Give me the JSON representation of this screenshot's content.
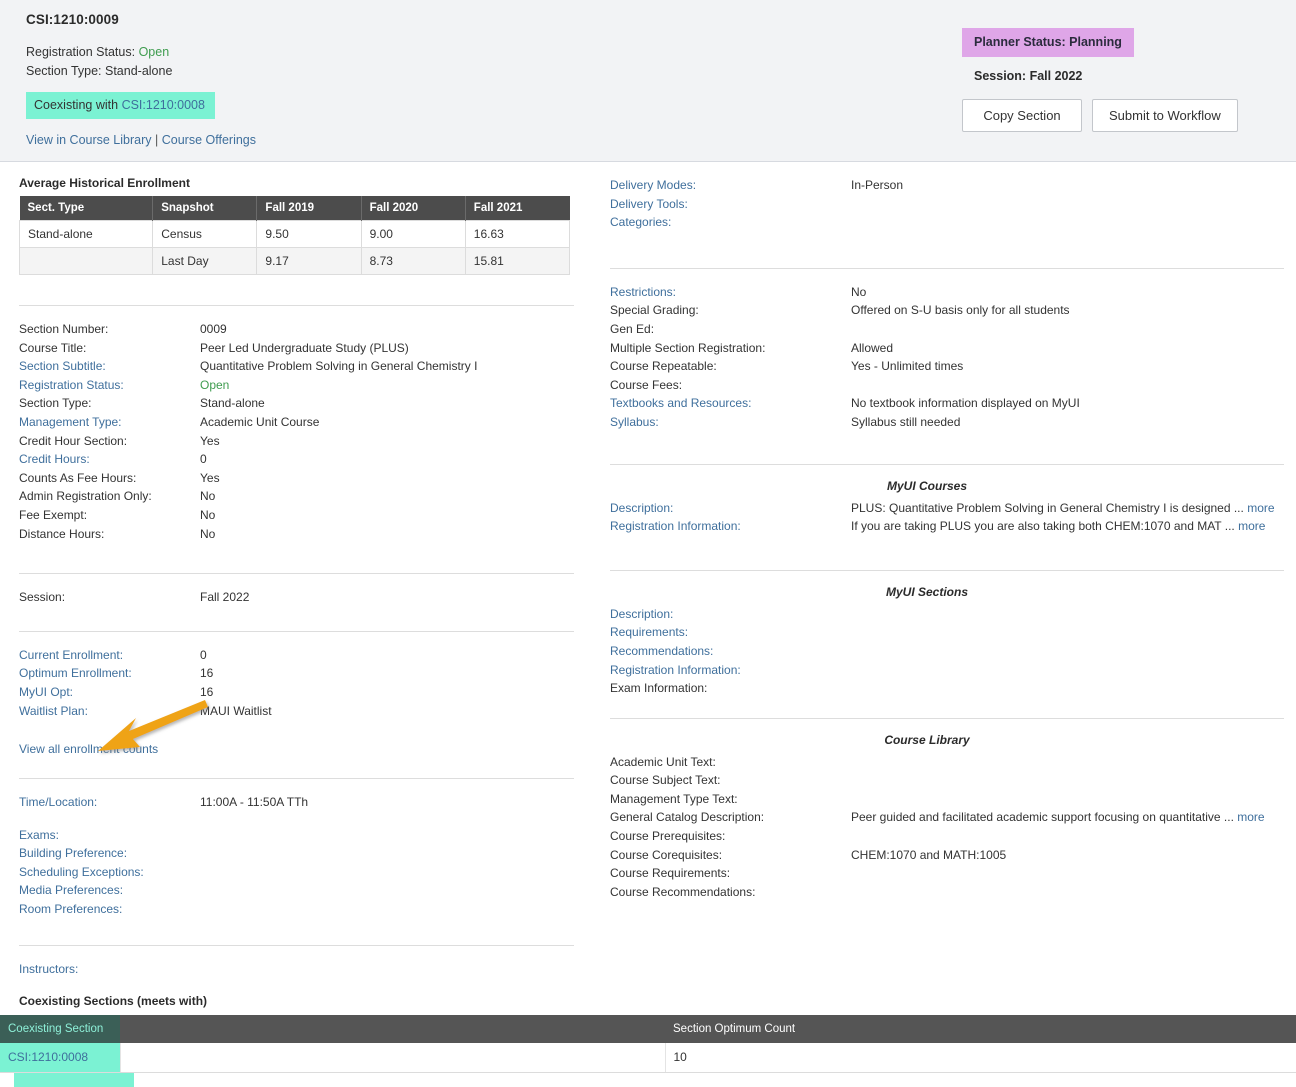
{
  "header": {
    "title": "CSI:1210:0009",
    "registration_status_label": "Registration Status:",
    "registration_status_value": "Open",
    "section_type_label": "Section Type:",
    "section_type_value": "Stand-alone",
    "coexisting_prefix": "Coexisting with",
    "coexisting_link": "CSI:1210:0008",
    "view_course_library": "View in Course Library",
    "link_separator": "|",
    "course_offerings": "Course Offerings",
    "planner_status": "Planner Status: Planning",
    "session": "Session: Fall 2022",
    "copy_section_button": "Copy Section",
    "submit_workflow_button": "Submit to Workflow"
  },
  "historical": {
    "title": "Average Historical Enrollment",
    "columns": [
      "Sect. Type",
      "Snapshot",
      "Fall 2019",
      "Fall 2020",
      "Fall 2021"
    ],
    "rows": [
      {
        "type": "Stand-alone",
        "snapshot": "Census",
        "f2019": "9.50",
        "f2020": "9.00",
        "f2021": "16.63"
      },
      {
        "type": "",
        "snapshot": "Last Day",
        "f2019": "9.17",
        "f2020": "8.73",
        "f2021": "15.81"
      }
    ]
  },
  "left": {
    "details": [
      {
        "label": "Section Number:",
        "value": "0009",
        "link": false
      },
      {
        "label": "Course Title:",
        "value": "Peer Led Undergraduate Study (PLUS)",
        "link": false
      },
      {
        "label": "Section Subtitle:",
        "value": "Quantitative Problem Solving in General Chemistry I",
        "link": true
      },
      {
        "label": "Registration Status:",
        "value": "Open",
        "link": true,
        "green": true
      },
      {
        "label": "Section Type:",
        "value": "Stand-alone",
        "link": false
      },
      {
        "label": "Management Type:",
        "value": "Academic Unit Course",
        "link": true
      },
      {
        "label": "Credit Hour Section:",
        "value": "Yes",
        "link": false
      },
      {
        "label": "Credit Hours:",
        "value": "0",
        "link": true
      },
      {
        "label": "Counts As Fee Hours:",
        "value": "Yes",
        "link": false
      },
      {
        "label": "Admin Registration Only:",
        "value": "No",
        "link": false
      },
      {
        "label": "Fee Exempt:",
        "value": "No",
        "link": false
      },
      {
        "label": "Distance Hours:",
        "value": "No",
        "link": false
      }
    ],
    "session": [
      {
        "label": "Session:",
        "value": "Fall 2022",
        "link": false
      }
    ],
    "enrollment": [
      {
        "label": "Current Enrollment:",
        "value": "0",
        "link": true
      },
      {
        "label": "Optimum Enrollment:",
        "value": "16",
        "link": true
      },
      {
        "label": "MyUI Opt:",
        "value": "16",
        "link": true
      },
      {
        "label": "Waitlist Plan:",
        "value": "MAUI Waitlist",
        "link": true
      }
    ],
    "view_all_counts": "View all enrollment counts",
    "schedule": [
      {
        "label": "Time/Location:",
        "value": "11:00A - 11:50A TTh",
        "link": true
      }
    ],
    "prefs": [
      {
        "label": "Exams:",
        "value": "",
        "link": true
      },
      {
        "label": "Building Preference:",
        "value": "",
        "link": true
      },
      {
        "label": "Scheduling Exceptions:",
        "value": "",
        "link": true
      },
      {
        "label": "Media Preferences:",
        "value": "",
        "link": true
      },
      {
        "label": "Room Preferences:",
        "value": "",
        "link": true
      }
    ],
    "instructors": [
      {
        "label": "Instructors:",
        "value": "",
        "link": true
      }
    ]
  },
  "right": {
    "delivery": [
      {
        "label": "Delivery Modes:",
        "value": "In-Person",
        "link": true
      },
      {
        "label": "Delivery Tools:",
        "value": "",
        "link": true
      },
      {
        "label": "Categories:",
        "value": "",
        "link": true
      }
    ],
    "policies": [
      {
        "label": "Restrictions:",
        "value": "No",
        "link": true
      },
      {
        "label": "Special Grading:",
        "value": "Offered on S-U basis only for all students",
        "link": false
      },
      {
        "label": "Gen Ed:",
        "value": "",
        "link": false
      },
      {
        "label": "Multiple Section Registration:",
        "value": "Allowed",
        "link": false
      },
      {
        "label": "Course Repeatable:",
        "value": "Yes - Unlimited times",
        "link": false
      },
      {
        "label": "Course Fees:",
        "value": "",
        "link": false
      },
      {
        "label": "Textbooks and Resources:",
        "value": "No textbook information displayed on MyUI",
        "link": true
      },
      {
        "label": "Syllabus:",
        "value": "Syllabus still needed",
        "link": true
      }
    ],
    "myui_courses_heading": "MyUI Courses",
    "myui_courses": [
      {
        "label": "Description:",
        "value": "PLUS: Quantitative Problem Solving in General Chemistry I is designed ...",
        "more": "more",
        "link": true
      },
      {
        "label": "Registration Information:",
        "value": "If you are taking PLUS you are also taking both CHEM:1070 and MAT ...",
        "more": "more",
        "link": true
      }
    ],
    "myui_sections_heading": "MyUI Sections",
    "myui_sections": [
      {
        "label": "Description:",
        "value": "",
        "link": true
      },
      {
        "label": "Requirements:",
        "value": "",
        "link": true
      },
      {
        "label": "Recommendations:",
        "value": "",
        "link": true
      },
      {
        "label": "Registration Information:",
        "value": "",
        "link": true
      },
      {
        "label": "Exam Information:",
        "value": "",
        "link": false
      }
    ],
    "course_library_heading": "Course Library",
    "course_library": [
      {
        "label": "Academic Unit Text:",
        "value": "",
        "link": false
      },
      {
        "label": "Course Subject Text:",
        "value": "",
        "link": false
      },
      {
        "label": "Management Type Text:",
        "value": "",
        "link": false
      },
      {
        "label": "General Catalog Description:",
        "value": "Peer guided and facilitated academic support focusing on quantitative ...",
        "more": "more",
        "link": false
      },
      {
        "label": "Course Prerequisites:",
        "value": "",
        "link": false
      },
      {
        "label": "Course Corequisites:",
        "value": "CHEM:1070 and MATH:1005",
        "link": false
      },
      {
        "label": "Course Requirements:",
        "value": "",
        "link": false
      },
      {
        "label": "Course Recommendations:",
        "value": "",
        "link": false
      }
    ]
  },
  "coexisting": {
    "title": "Coexisting Sections (meets with)",
    "columns": [
      "Coexisting Section",
      "",
      "Section Optimum Count"
    ],
    "rows": [
      {
        "section": "CSI:1210:0008",
        "blank": "",
        "optimum": "10"
      }
    ]
  },
  "annotation": {
    "arrow_color": "#EFA316",
    "arrow_target": "Time/Location:"
  },
  "colors": {
    "header_bg": "#F2F3F5",
    "teal_highlight": "#7BF2D3",
    "purple_badge": "#DFA6E8",
    "table_header": "#4C4C4C",
    "link_blue": "#3F6F9C",
    "status_green": "#3F9C4F"
  }
}
